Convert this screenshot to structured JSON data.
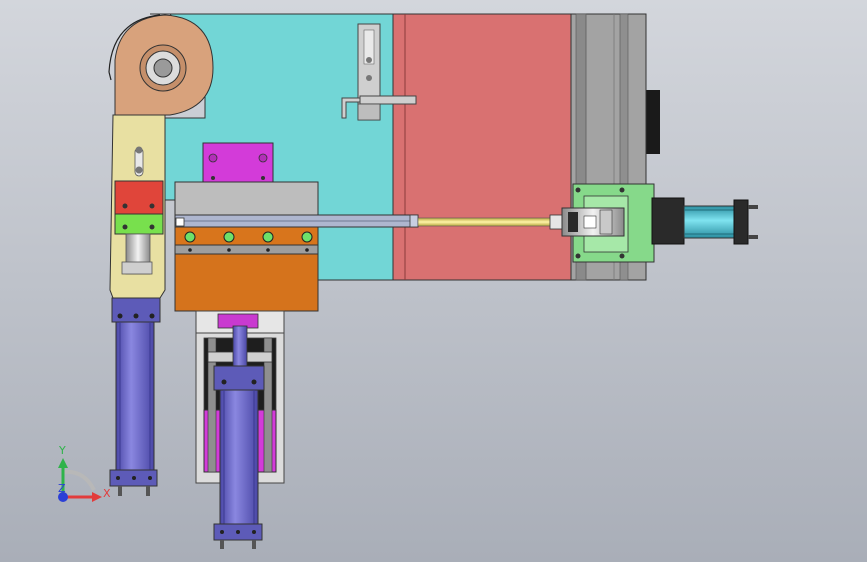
{
  "view": {
    "background_top": "#d3d6dc",
    "background_bottom": "#a9aeb8"
  },
  "triad": {
    "x_label": "X",
    "y_label": "Y",
    "z_label": "Z",
    "x_color": "#e23b3b",
    "y_color": "#2fb34a",
    "z_color": "#2b3fd6"
  },
  "colors": {
    "teal_panel": "#72d6d6",
    "red_panel": "#d97171",
    "grey_rail": "#9c9c9c",
    "salmon_arm": "#d8a27c",
    "khaki_arm": "#e8e0a2",
    "magenta": "#d33bd9",
    "orange_block": "#d5731c",
    "blue_cylinder": "#6c69c9",
    "yellow_rod": "#e6d877",
    "green_plate": "#86d98a",
    "cyan_cylinder": "#3fb6c9"
  }
}
